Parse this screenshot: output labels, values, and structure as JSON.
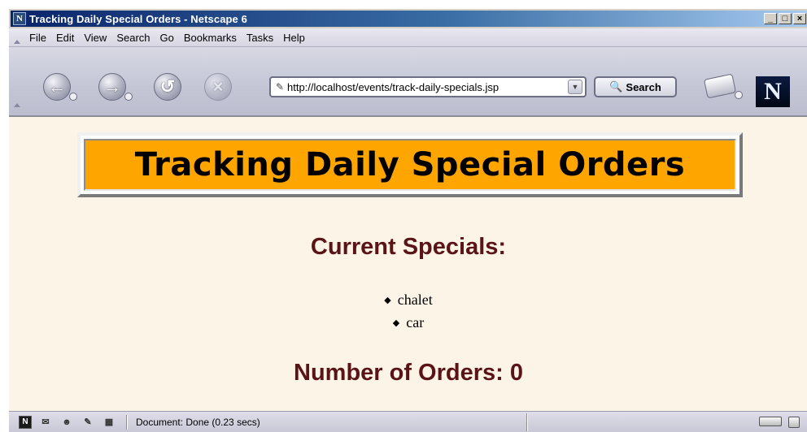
{
  "window": {
    "title": "Tracking Daily Special Orders - Netscape 6",
    "app_icon_letter": "N",
    "buttons": {
      "minimize": "_",
      "maximize": "□",
      "close": "×"
    }
  },
  "menubar": {
    "items": [
      {
        "label": "File"
      },
      {
        "label": "Edit"
      },
      {
        "label": "View"
      },
      {
        "label": "Search"
      },
      {
        "label": "Go"
      },
      {
        "label": "Bookmarks"
      },
      {
        "label": "Tasks"
      },
      {
        "label": "Help"
      }
    ]
  },
  "toolbar": {
    "back_icon": "back-arrow-icon",
    "forward_icon": "forward-arrow-icon",
    "reload_icon": "reload-icon",
    "stop_icon": "stop-icon",
    "url": "http://localhost/events/track-daily-specials.jsp",
    "search_label": "Search",
    "logo_letter": "N"
  },
  "page": {
    "banner": "Tracking Daily Special Orders",
    "specials_heading": "Current Specials:",
    "specials": [
      "chalet",
      "car"
    ],
    "orders_heading": "Number of Orders: 0"
  },
  "statusbar": {
    "text": "Document: Done (0.23 secs)"
  },
  "colors": {
    "banner_bg": "#ffa500",
    "page_bg": "#fdf4e8",
    "heading": "#5a1418"
  }
}
